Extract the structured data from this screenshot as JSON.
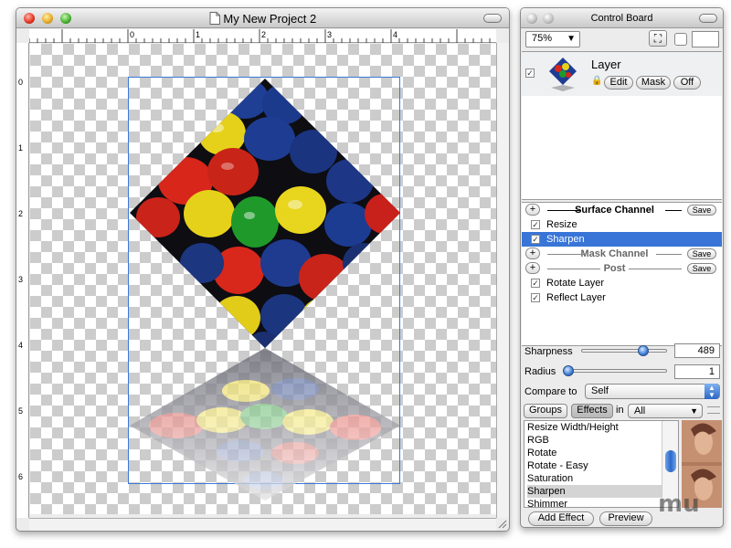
{
  "main_window": {
    "title": "My New Project 2",
    "ruler_h": [
      "0",
      "1",
      "2",
      "3",
      "4"
    ],
    "ruler_v": [
      "0",
      "1",
      "2",
      "3",
      "4",
      "5",
      "6"
    ]
  },
  "control_board": {
    "title": "Control Board",
    "zoom": "75%",
    "layer": {
      "name": "Layer",
      "edit": "Edit",
      "mask": "Mask",
      "off": "Off"
    },
    "channels": [
      {
        "type": "section",
        "label": "Surface Channel",
        "save": "Save"
      },
      {
        "type": "item",
        "label": "Resize",
        "checked": true
      },
      {
        "type": "item",
        "label": "Sharpen",
        "checked": true,
        "selected": true
      },
      {
        "type": "section",
        "label": "Mask Channel",
        "save": "Save",
        "dim": true
      },
      {
        "type": "section",
        "label": "Post",
        "save": "Save",
        "dim": true
      },
      {
        "type": "item",
        "label": "Rotate Layer",
        "checked": true
      },
      {
        "type": "item",
        "label": "Reflect Layer",
        "checked": true
      }
    ],
    "params": {
      "sharpness_label": "Sharpness",
      "sharpness_value": "489",
      "sharpness_level": 0.72,
      "radius_label": "Radius",
      "radius_value": "1",
      "radius_level": 0.02,
      "compare_label": "Compare to",
      "compare_value": "Self"
    },
    "filter": {
      "groups": "Groups",
      "effects": "Effects",
      "in_label": "in",
      "scope": "All"
    },
    "effects_list": [
      "Resize Width/Height",
      "RGB",
      "Rotate",
      "Rotate - Easy",
      "Saturation",
      "Sharpen",
      "Shimmer"
    ],
    "effects_selected": "Sharpen",
    "add_effect": "Add Effect",
    "preview": "Preview",
    "watermark": "mu",
    "colors": {
      "selection": "#3875d7",
      "accent_blue": "#3d7fd8"
    }
  }
}
